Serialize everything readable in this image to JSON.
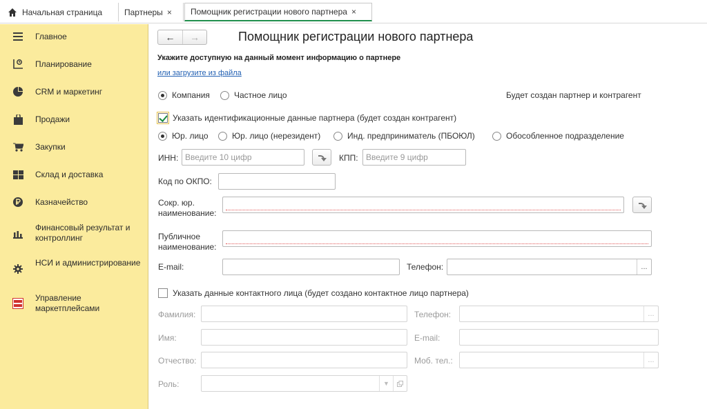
{
  "tabs": [
    {
      "label": "Начальная страница",
      "closable": false
    },
    {
      "label": "Партнеры",
      "closable": true
    },
    {
      "label": "Помощник регистрации нового партнера",
      "closable": true,
      "active": true
    }
  ],
  "tab_close_glyph": "×",
  "sidebar": {
    "items": [
      {
        "label": "Главное",
        "icon": "menu-icon"
      },
      {
        "label": "Планирование",
        "icon": "planning-icon"
      },
      {
        "label": "CRM и маркетинг",
        "icon": "crm-icon"
      },
      {
        "label": "Продажи",
        "icon": "bag-icon"
      },
      {
        "label": "Закупки",
        "icon": "cart-icon"
      },
      {
        "label": "Склад и доставка",
        "icon": "warehouse-icon"
      },
      {
        "label": "Казначейство",
        "icon": "treasury-icon"
      },
      {
        "label": "Финансовый результат и контроллинг",
        "icon": "chart-icon"
      },
      {
        "label": "НСИ и администрирование",
        "icon": "gear-icon"
      },
      {
        "label": "Управление маркетплейсами",
        "icon": "marketplace-icon"
      }
    ]
  },
  "main": {
    "back_glyph": "←",
    "forward_glyph": "→",
    "title": "Помощник регистрации нового партнера",
    "subtitle": "Укажите доступную на данный момент информацию о партнере",
    "load_link": "или загрузите из файла",
    "partner_type": {
      "options": [
        "Компания",
        "Частное лицо"
      ],
      "selected": "Компания"
    },
    "info_text": "Будет создан партнер и контрагент",
    "ident_check": {
      "label": "Указать идентификационные данные партнера (будет создан контрагент)",
      "checked": true
    },
    "legal_type": {
      "options": [
        "Юр. лицо",
        "Юр. лицо (нерезидент)",
        "Инд. предприниматель (ПБОЮЛ)",
        "Обособленное подразделение"
      ],
      "selected": "Юр. лицо"
    },
    "inn": {
      "label": "ИНН:",
      "placeholder": "Введите 10 цифр"
    },
    "kpp": {
      "label": "КПП:",
      "placeholder": "Введите 9 цифр"
    },
    "okpo": {
      "label": "Код по ОКПО:",
      "value": ""
    },
    "short_name": {
      "label_line1": "Сокр. юр.",
      "label_line2": "наименование:",
      "value": ""
    },
    "public_name": {
      "label_line1": "Публичное",
      "label_line2": "наименование:",
      "value": ""
    },
    "email": {
      "label": "E-mail:",
      "value": ""
    },
    "phone": {
      "label": "Телефон:",
      "value": ""
    },
    "dots_glyph": "...",
    "contact_check": {
      "label": "Указать данные контактного лица (будет создано контактное лицо партнера)",
      "checked": false
    },
    "contact": {
      "surname_label": "Фамилия:",
      "phone_label": "Телефон:",
      "name_label": "Имя:",
      "email_label": "E-mail:",
      "patronymic_label": "Отчество:",
      "mobile_label": "Моб. тел.:",
      "role_label": "Роль:"
    }
  },
  "colors": {
    "sidebar_bg": "#fbeb9d",
    "active_tab_underline": "#1f8f4c",
    "link": "#2361b3",
    "required_underline": "#e05050"
  }
}
